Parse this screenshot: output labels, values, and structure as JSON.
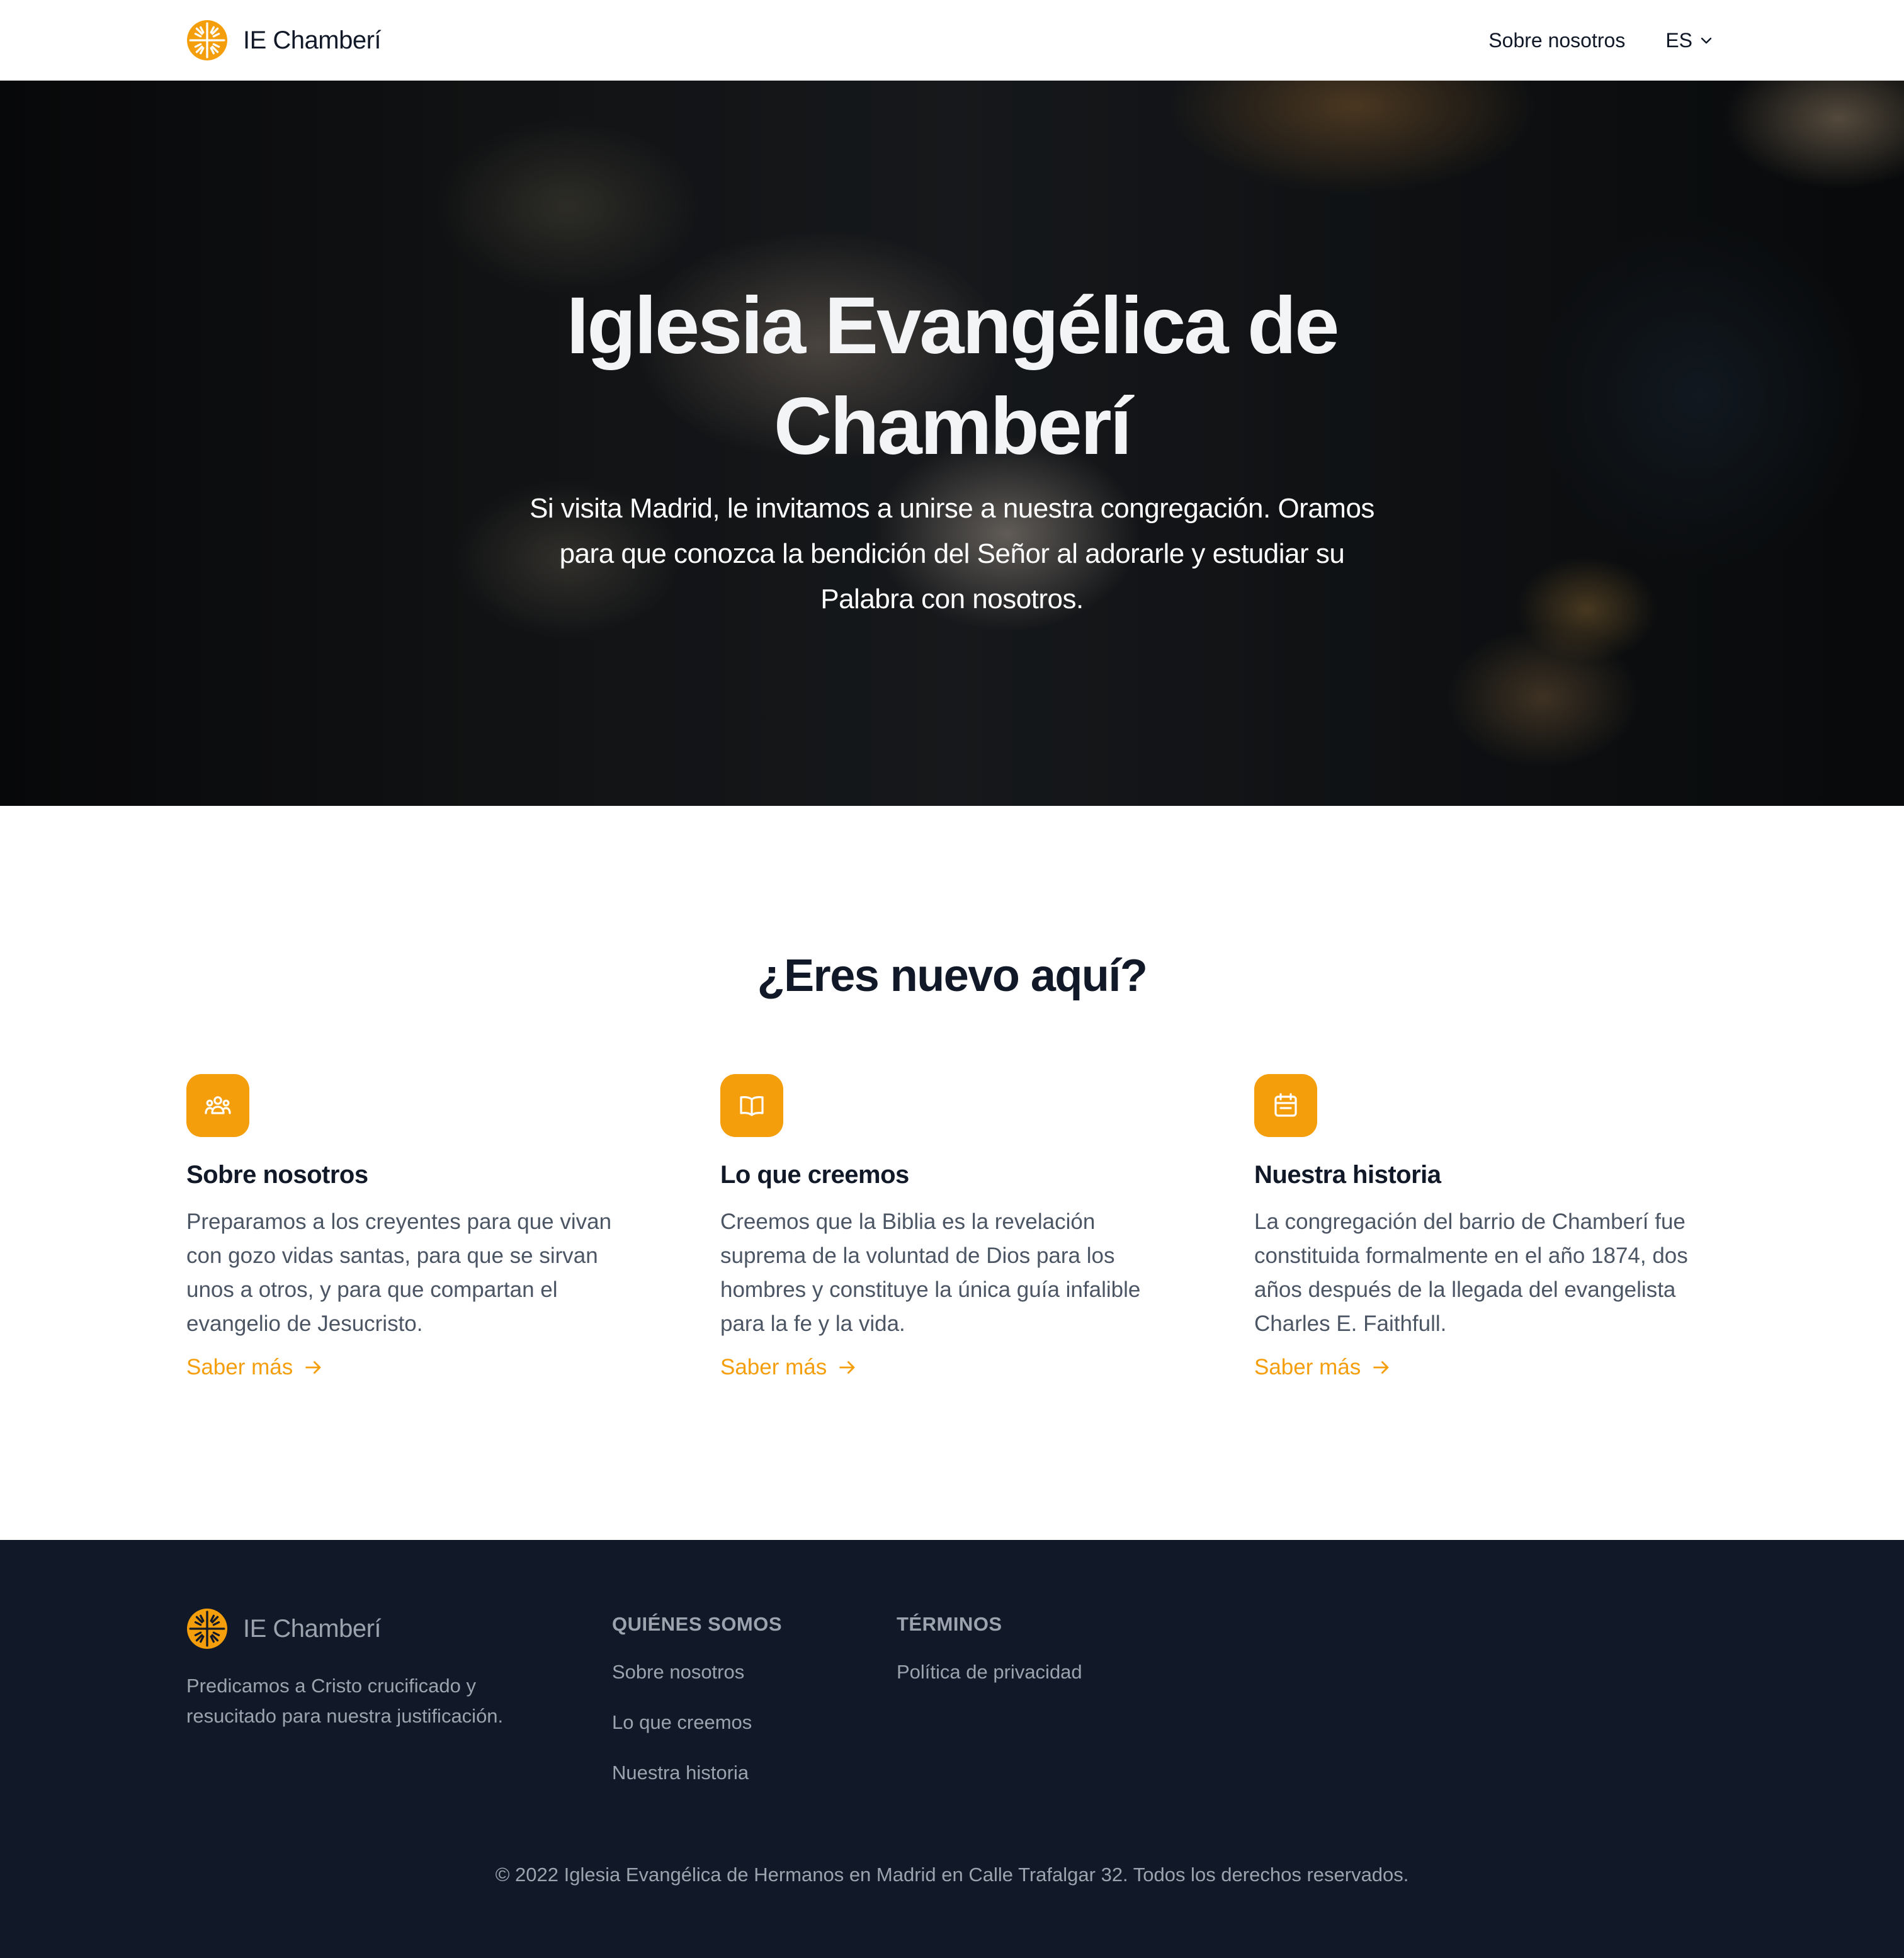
{
  "nav": {
    "brand": "IE Chamberí",
    "links": [
      "Sobre nosotros"
    ],
    "language": "ES"
  },
  "hero": {
    "title": "Iglesia Evangélica de Chamberí",
    "subtitle": "Si visita Madrid, le invitamos a unirse a nuestra congregación. Oramos para que conozca la bendición del Señor al adorarle y estudiar su Palabra con nosotros."
  },
  "intro": {
    "heading": "¿Eres nuevo aquí?",
    "features": [
      {
        "icon": "users-icon",
        "title": "Sobre nosotros",
        "text": "Preparamos a los creyentes para que vivan con gozo vidas santas, para que se sirvan unos a otros, y para que compartan el evangelio de Jesucristo.",
        "link": "Saber más"
      },
      {
        "icon": "book-open-icon",
        "title": "Lo que creemos",
        "text": "Creemos que la Biblia es la revelación suprema de la voluntad de Dios para los hombres y constituye la única guía infalible para la fe y la vida.",
        "link": "Saber más"
      },
      {
        "icon": "calendar-icon",
        "title": "Nuestra historia",
        "text": "La congregación del barrio de Chamberí fue constituida formalmente en el año 1874, dos años después de la llegada del evangelista Charles E. Faithfull.",
        "link": "Saber más"
      }
    ]
  },
  "footer": {
    "brand": "IE Chamberí",
    "tagline": "Predicamos a Cristo crucificado y resucitado para nuestra justificación.",
    "columns": [
      {
        "title": "QUIÉNES SOMOS",
        "items": [
          "Sobre nosotros",
          "Lo que creemos",
          "Nuestra historia"
        ]
      },
      {
        "title": "TÉRMINOS",
        "items": [
          "Política de privacidad"
        ]
      }
    ],
    "copyright": "© 2022 Iglesia Evangélica de Hermanos en Madrid en Calle Trafalgar 32. Todos los derechos reservados."
  },
  "colors": {
    "accent": "#f59e0b",
    "footer_bg": "#111827",
    "text_dark": "#111827",
    "text_muted": "#4b5563",
    "footer_text": "#9ca3af"
  }
}
